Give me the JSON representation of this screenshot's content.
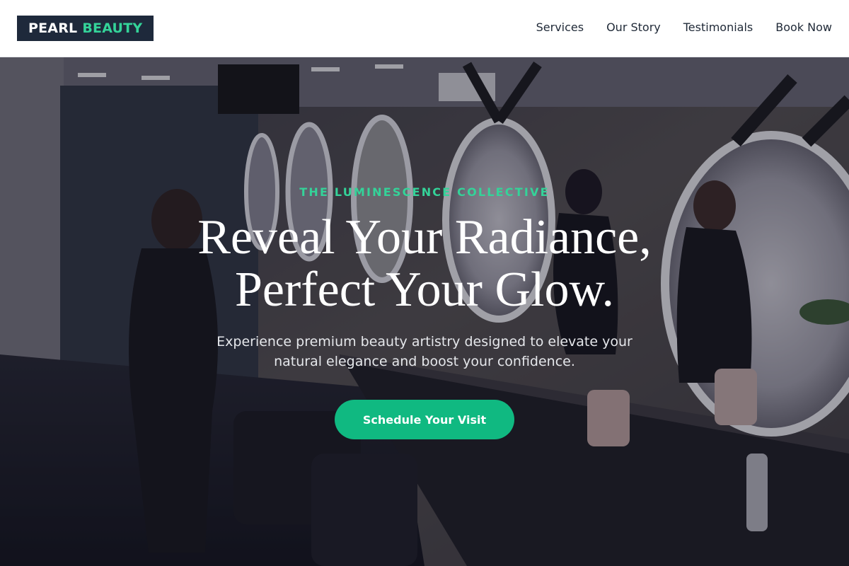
{
  "header": {
    "brand_primary": "PEARL",
    "brand_accent": "BEAUTY",
    "nav": [
      {
        "label": "Services"
      },
      {
        "label": "Our Story"
      },
      {
        "label": "Testimonials"
      },
      {
        "label": "Book Now"
      }
    ]
  },
  "hero": {
    "eyebrow": "THE LUMINESCENCE COLLECTIVE",
    "headline_line1": "Reveal Your Radiance,",
    "headline_line2": "Perfect Your Glow.",
    "subtext_line1": "Experience premium beauty artistry designed to elevate your",
    "subtext_line2": "natural elegance and boost your confidence.",
    "cta_label": "Schedule Your Visit"
  },
  "colors": {
    "brand_dark": "#1e293b",
    "accent_green": "#34d399",
    "button_green": "#10b981"
  }
}
